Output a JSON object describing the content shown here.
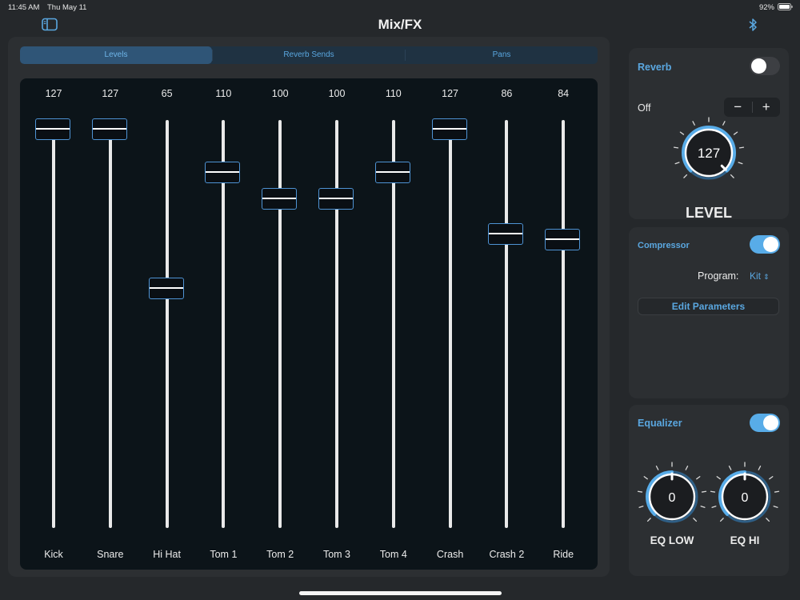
{
  "status_bar": {
    "time": "11:45 AM",
    "date": "Thu May 11",
    "battery_percent": "92%"
  },
  "nav": {
    "title": "Mix/FX",
    "left_icon": "sidebar-icon",
    "right_icon": "bluetooth-icon"
  },
  "tabs": [
    {
      "label": "Levels",
      "selected": true
    },
    {
      "label": "Reverb Sends",
      "selected": false
    },
    {
      "label": "Pans",
      "selected": false
    }
  ],
  "mixer": {
    "max_value": 127,
    "channels": [
      {
        "label": "Kick",
        "value": "127",
        "level": 127
      },
      {
        "label": "Snare",
        "value": "127",
        "level": 127
      },
      {
        "label": "Hi Hat",
        "value": "65",
        "level": 65
      },
      {
        "label": "Tom 1",
        "value": "110",
        "level": 110
      },
      {
        "label": "Tom 2",
        "value": "100",
        "level": 100
      },
      {
        "label": "Tom 3",
        "value": "100",
        "level": 100
      },
      {
        "label": "Tom 4",
        "value": "110",
        "level": 110
      },
      {
        "label": "Crash",
        "value": "127",
        "level": 127
      },
      {
        "label": "Crash 2",
        "value": "86",
        "level": 86
      },
      {
        "label": "Ride",
        "value": "84",
        "level": 84
      }
    ]
  },
  "reverb": {
    "title": "Reverb",
    "enabled": false,
    "state_label": "Off",
    "minus_label": "−",
    "plus_label": "+",
    "knob_value": "127",
    "knob_level_fraction": 1.0,
    "knob_caption": "LEVEL"
  },
  "compressor": {
    "title": "Compressor",
    "enabled": true,
    "program_label": "Program:",
    "program_value": "Kit",
    "edit_button": "Edit Parameters"
  },
  "equalizer": {
    "title": "Equalizer",
    "enabled": true,
    "low": {
      "value": "0",
      "caption": "EQ LOW"
    },
    "high": {
      "value": "0",
      "caption": "EQ HI"
    }
  },
  "colors": {
    "accent": "#5aa7e0",
    "background": "#25282b",
    "panel": "#2c2f32",
    "mixer_bg": "#0c1419"
  }
}
